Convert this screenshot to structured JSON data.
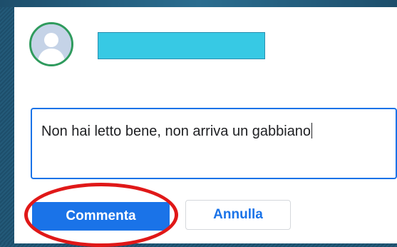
{
  "comment": {
    "text": "Non hai letto bene, non arriva un gabbiano"
  },
  "buttons": {
    "submit_label": "Commenta",
    "cancel_label": "Annulla"
  },
  "colors": {
    "accent": "#1a73e8",
    "redaction": "#37c9e4",
    "highlight": "#e01818",
    "avatar_border": "#2f9b5d"
  },
  "icons": {
    "avatar": "default-user-avatar"
  }
}
